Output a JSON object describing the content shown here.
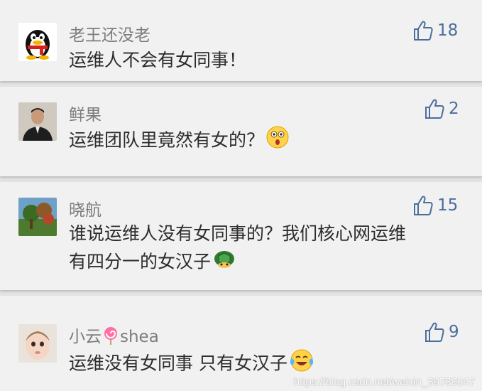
{
  "comments": [
    {
      "user": "老王还没老",
      "text": "运维人不会有女同事！",
      "likes": "18",
      "avatar": "qq-penguin-avatar"
    },
    {
      "user": "鲜果",
      "text": "运维团队里竟然有女的？",
      "likes": "2",
      "avatar": "man-photo-avatar",
      "emoji": "surprised-face-emoji"
    },
    {
      "user": "晓航",
      "text_line1": "谁说运维人没有女同事的？我们核心网运维",
      "text_line2": "有四分一的女汉子",
      "likes": "15",
      "avatar": "landscape-photo-avatar",
      "emoji": "turtle-emoji"
    },
    {
      "user_prefix": "小云",
      "user_suffix": "shea",
      "user_emoji": "lollipop-emoji",
      "text": "运维没有女同事 只有女汉子",
      "likes": "9",
      "avatar": "child-photo-avatar",
      "emoji": "tears-of-joy-emoji"
    }
  ],
  "watermark": "https://blog.csdn.net/weixin_39780047",
  "colors": {
    "like": "#4a6d9c",
    "name": "#7d7d7d",
    "text": "#2c2c2c",
    "card": "#f2f1f1",
    "divider": "#e3e3e3"
  }
}
